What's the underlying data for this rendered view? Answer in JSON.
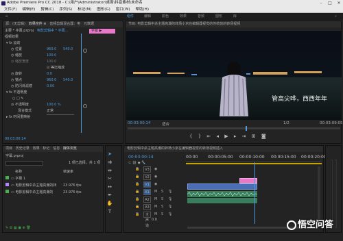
{
  "window": {
    "title": "Adobe Premiere Pro CC 2018 - C:\\用户\\Administrator\\桌面\\抖音素材\\未命名"
  },
  "menu": [
    "文件(F)",
    "编辑(E)",
    "剪辑(C)",
    "序列(S)",
    "标记(M)",
    "图形(G)",
    "窗口(W)",
    "帮助(H)"
  ],
  "workspaces": [
    "组件",
    "编辑",
    "颜色",
    "效果",
    "音频",
    "图形",
    "库"
  ],
  "effect_controls": {
    "tabs": [
      "源：(无剪辑)",
      "效果控件 ≡",
      "音频剪辑混合器：电",
      "元数据",
      "Lumetri 范围"
    ],
    "clip_path": "主要 * 字幕.prproj",
    "sequence": "电影剪辑中 * 字幕...",
    "badge": "字幕 ▶",
    "section_video": "视频效果",
    "motion": "运动",
    "position_label": "位置",
    "position_x": "960.0",
    "position_y": "540.0",
    "scale_label": "缩放",
    "scale_val": "100.0",
    "scale_w_label": "缩放宽度",
    "scale_w_val": "100.0",
    "uniform_label": "等比缩放",
    "rotation_label": "旋转",
    "rotation_val": "0.0",
    "anchor_label": "锚点",
    "anchor_x": "960.0",
    "anchor_y": "540.0",
    "flicker_label": "防闪烁滤镜",
    "flicker_val": "0.00",
    "opacity": "不透明度",
    "opacity_label": "不透明度",
    "opacity_val": "100.0 %",
    "blend_label": "混合模式",
    "blend_val": "正常",
    "time_remap": "时间重映射",
    "timecode": "00:03:00:14"
  },
  "program": {
    "tab": "节目: 电影剪辑中杀主题高潮的转场小京在编辑器视觉的传统前的转场视频",
    "subtitle": "管高尖哗，西西年年",
    "timecode": "00:03:00:14",
    "fit": "适合",
    "ratio": "1/2",
    "duration": "00:03:09:05"
  },
  "project": {
    "tabs": [
      "项目",
      "历史记录",
      "效果",
      "标记",
      "信息",
      "媒体浏览"
    ],
    "name": "字幕.prproj",
    "count": "1 项已选择，共 1 项",
    "col_name": "名称",
    "col_rate": "帧速率",
    "items": [
      {
        "name": "字幕 1",
        "rate": "",
        "color": "#4caf50"
      },
      {
        "name": "电影剪辑中杀主题高潮的转",
        "rate": "23.976 fps",
        "color": "#b388ff"
      },
      {
        "name": "电影剪辑中杀主题高潮的",
        "rate": "23.976 fps",
        "color": "#4caf50"
      }
    ]
  },
  "timeline": {
    "tab": "电影剪辑中杀主题高潮的转场小京在编辑器视觉的转场视频插入",
    "timecode": "00:03:00:14",
    "ruler": [
      "00:00",
      "00:00:05:00",
      "00:00:10:00",
      "00:00:15:00",
      "00:00:20:00"
    ],
    "tracks": [
      "V3",
      "V2",
      "V1",
      "A1",
      "A2",
      "A3",
      "主声道"
    ],
    "master_val": "0.0"
  },
  "watermark": "悟空问答",
  "colors": {
    "accent": "#4d9de0",
    "playhead": "#4d9de0",
    "clip_pink": "#e879c8",
    "clip_blue": "#4a6fb8",
    "audio_green": "#3a7d5c"
  }
}
